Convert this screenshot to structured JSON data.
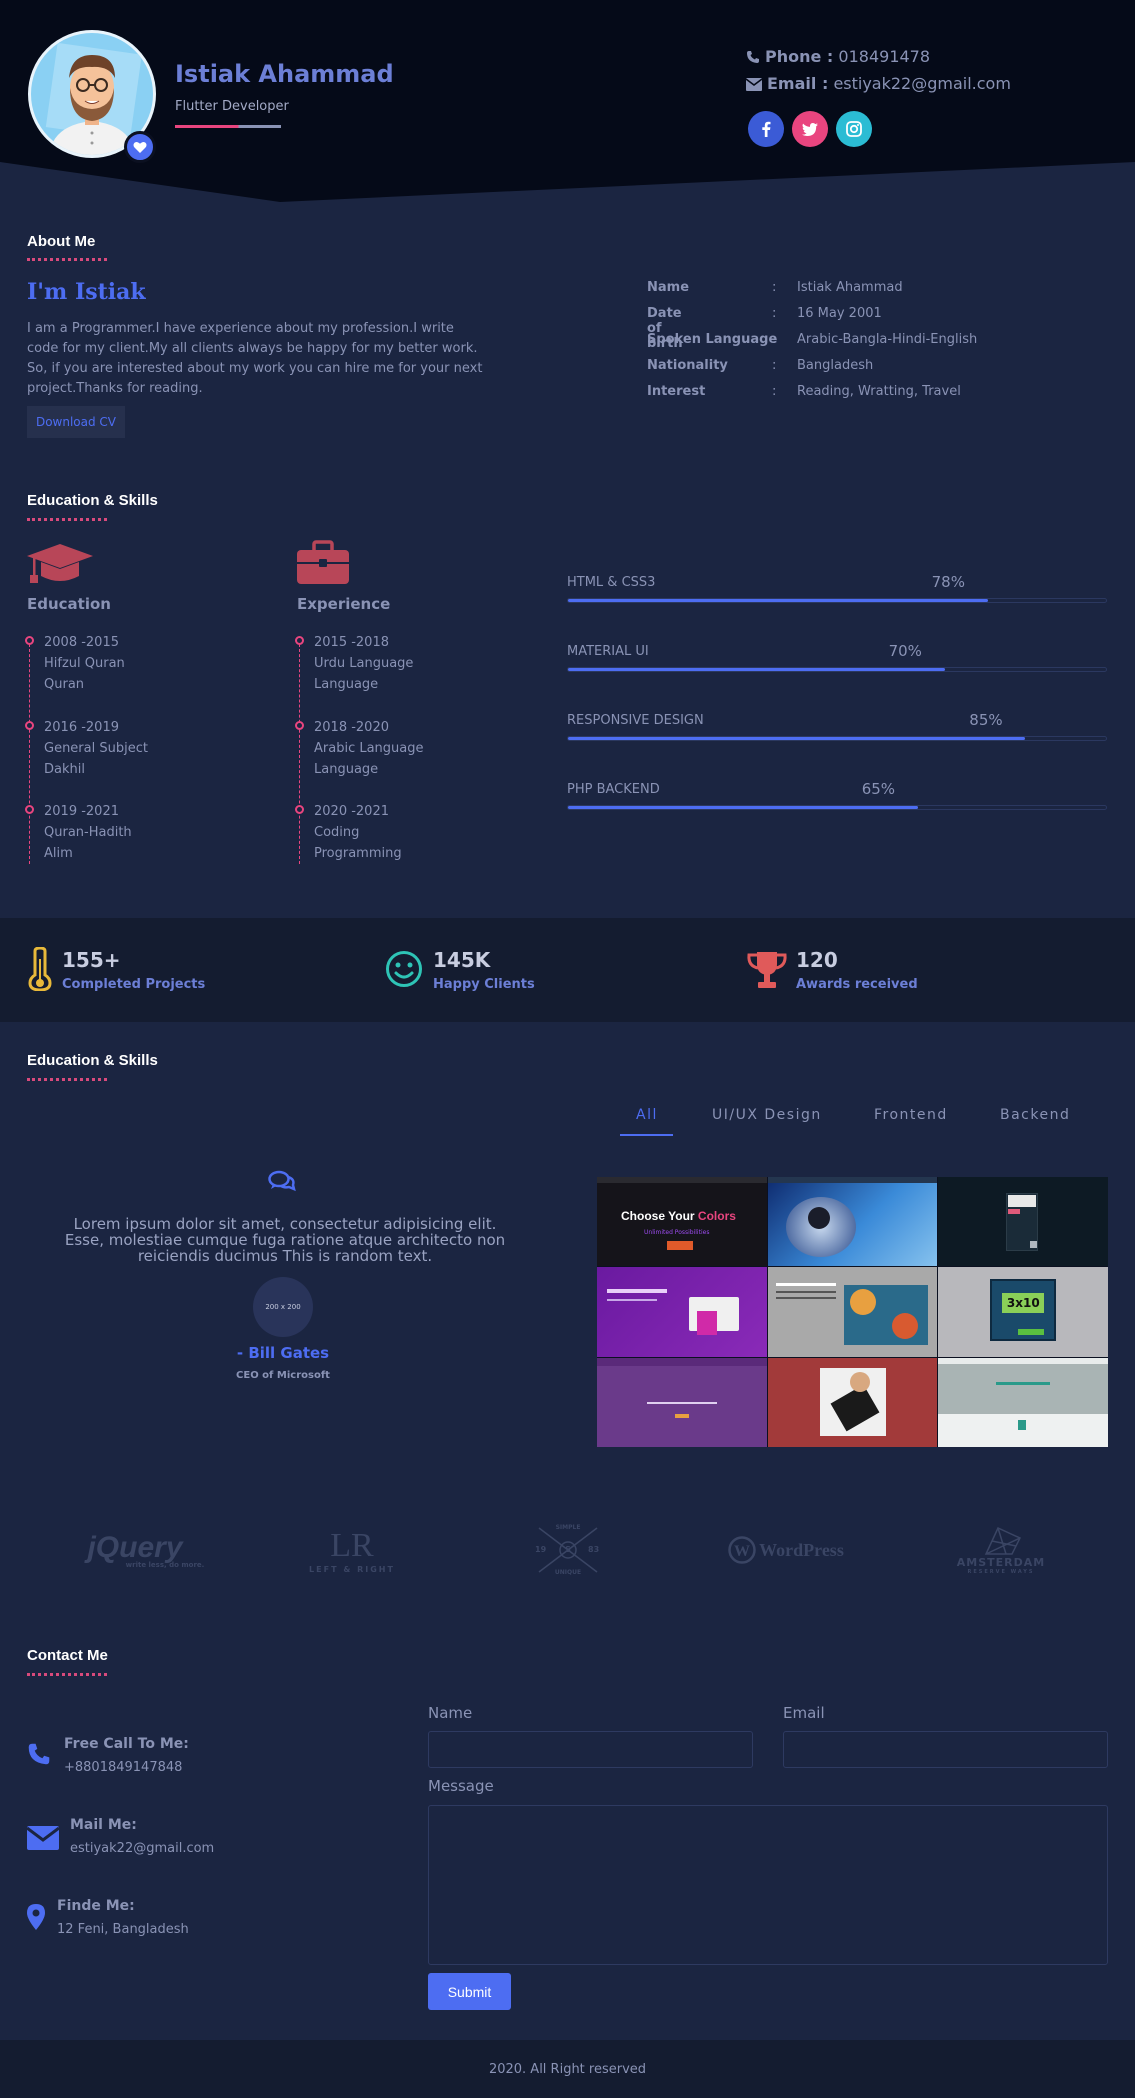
{
  "profile": {
    "name": "Istiak Ahammad",
    "role": "Flutter Developer",
    "phone_label": "Phone :",
    "phone": "018491478",
    "email_label": "Email :",
    "email": "estiyak22@gmail.com",
    "social": [
      "facebook-icon",
      "twitter-icon",
      "instagram-icon"
    ]
  },
  "about": {
    "section_title": "About Me",
    "greeting": "I'm Istiak",
    "bio": "I am a Programmer.I have experience about my profession.I write code for my client.My all clients always be happy for my better work. So, if you are interested about my work you can hire me for your next project.Thanks for reading.",
    "download_label": "Download CV",
    "info": [
      {
        "label": "Name",
        "sep": ":",
        "value": "Istiak Ahammad"
      },
      {
        "label": "Date of birth",
        "sep": ":",
        "value": "16 May 2001"
      },
      {
        "label": "Spoken Language",
        "sep": ":",
        "value": "Arabic-Bangla-Hindi-English"
      },
      {
        "label": "Nationality",
        "sep": ":",
        "value": "Bangladesh"
      },
      {
        "label": "Interest",
        "sep": ":",
        "value": "Reading, Wratting, Travel"
      }
    ]
  },
  "education": {
    "section_title": "Education & Skills",
    "education_heading": "Education",
    "experience_heading": "Experience",
    "education_items": [
      {
        "year": "2008 -2015",
        "line1": "Hifzul Quran",
        "line2": "Quran"
      },
      {
        "year": "2016 -2019",
        "line1": "General Subject",
        "line2": "Dakhil"
      },
      {
        "year": "2019 -2021",
        "line1": "Quran-Hadith",
        "line2": "Alim"
      }
    ],
    "experience_items": [
      {
        "year": "2015 -2018",
        "line1": "Urdu Language",
        "line2": "Language"
      },
      {
        "year": "2018 -2020",
        "line1": "Arabic Language",
        "line2": "Language"
      },
      {
        "year": "2020 -2021",
        "line1": "Coding",
        "line2": "Programming"
      }
    ],
    "skills": [
      {
        "label": "HTML & CSS3",
        "percent_text": "78%",
        "value": 78
      },
      {
        "label": "MATERIAL UI",
        "percent_text": "70%",
        "value": 70
      },
      {
        "label": "RESPONSIVE DESIGN",
        "percent_text": "85%",
        "value": 85
      },
      {
        "label": "PHP BACKEND",
        "percent_text": "65%",
        "value": 65
      }
    ]
  },
  "stats": [
    {
      "number": "155+",
      "label": "Completed Projects",
      "icon": "thermometer-icon",
      "color": "#e8b93a"
    },
    {
      "number": "145K",
      "label": "Happy Clients",
      "icon": "smile-icon",
      "color": "#2ec4b6"
    },
    {
      "number": "120",
      "label": "Awards received",
      "icon": "trophy-icon",
      "color": "#e05a5a"
    }
  ],
  "portfolio": {
    "section_title": "Education & Skills",
    "tabs": [
      "All",
      "UI/UX Design",
      "Frontend",
      "Backend"
    ],
    "active_tab": "All",
    "quote": "Lorem ipsum dolor sit amet, consectetur adipisicing elit. Esse, molestiae cumque fuga ratione atque architecto non reiciendis ducimus This is random text.",
    "quote_avatar_text": "200 x 200",
    "author": "- Bill Gates",
    "author_title": "CEO of Microsoft",
    "thumb1_title": "Choose Your",
    "thumb1_title_accent": "Colors",
    "thumb1_sub": "Unlimited Possibilities",
    "thumb5_title": "3x10"
  },
  "brands": {
    "jquery": "jQuery",
    "jquery_tag": "write less, do more.",
    "lr": "LR",
    "lr_sub": "LEFT & RIGHT",
    "simple_top": "SIMPLE",
    "simple_bottom": "UNIQUE",
    "simple_left": "19",
    "simple_right": "83",
    "simple_mid": "S",
    "wordpress": "WordPress",
    "amsterdam": "AMSTERDAM",
    "amsterdam_sub": "RESERVE WAYS"
  },
  "contact": {
    "section_title": "Contact Me",
    "call_label": "Free Call To Me:",
    "call_value": "+8801849147848",
    "mail_label": "Mail Me:",
    "mail_value": "estiyak22@gmail.com",
    "find_label": "Finde Me:",
    "find_value": "12 Feni, Bangladesh",
    "name_label": "Name",
    "email_label": "Email",
    "message_label": "Message",
    "submit_label": "Submit"
  },
  "footer": {
    "text": "2020. All Right reserved"
  },
  "colors": {
    "accent": "#4d6df2",
    "pink": "#e9457f",
    "background": "#1b2541",
    "header": "#050a18"
  }
}
